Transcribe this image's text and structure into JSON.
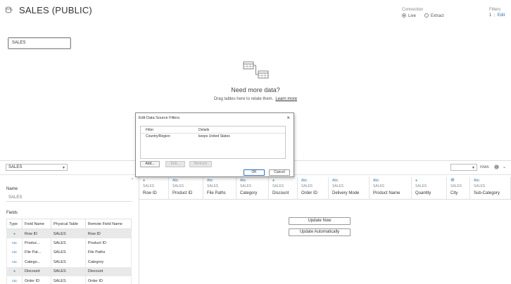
{
  "header": {
    "title": "SALES (PUBLIC)",
    "connection_label": "Connection",
    "connection_options": [
      "Live",
      "Extract"
    ],
    "connection_selected": "Live",
    "filters_label": "Filters",
    "filters_count": "1",
    "filters_edit": "Edit"
  },
  "canvas": {
    "table_chip": "SALES",
    "empty_title": "Need more data?",
    "empty_subtitle": "Drag tables here to relate them.",
    "learn_more": "Learn more"
  },
  "toolbar": {
    "connection_select": "SALES",
    "rows_label": "rows"
  },
  "left_panel": {
    "name_label": "Name",
    "name_value": "SALES",
    "fields_label": "Fields",
    "columns": [
      "Type",
      "Field Name",
      "Physical Table",
      "Remote Field Name"
    ],
    "rows": [
      {
        "type": "num",
        "field": "Row ID",
        "table": "SALES",
        "remote": "Row ID",
        "selected": true
      },
      {
        "type": "abc",
        "field": "Produc...",
        "table": "SALES",
        "remote": "Product ID",
        "selected": false
      },
      {
        "type": "abc",
        "field": "File Pat...",
        "table": "SALES",
        "remote": "File Paths",
        "selected": false
      },
      {
        "type": "abc",
        "field": "Catego...",
        "table": "SALES",
        "remote": "Category",
        "selected": false
      },
      {
        "type": "num",
        "field": "Discount",
        "table": "SALES",
        "remote": "Discount",
        "selected": true
      },
      {
        "type": "abc",
        "field": "Order ID",
        "table": "SALES",
        "remote": "Order ID",
        "selected": false
      }
    ]
  },
  "grid": {
    "columns": [
      {
        "type": "num",
        "type_label": "#",
        "source": "SALES",
        "name": "Row ID"
      },
      {
        "type": "abc",
        "type_label": "Abc",
        "source": "SALES",
        "name": "Product ID"
      },
      {
        "type": "abc",
        "type_label": "Abc",
        "source": "SALES",
        "name": "File Paths"
      },
      {
        "type": "abc",
        "type_label": "Abc",
        "source": "SALES",
        "name": "Category"
      },
      {
        "type": "num",
        "type_label": "#",
        "source": "SALES",
        "name": "Discount"
      },
      {
        "type": "abc",
        "type_label": "Abc",
        "source": "SALES",
        "name": "Order ID"
      },
      {
        "type": "abc",
        "type_label": "Abc",
        "source": "SALES",
        "name": "Delivery Mode"
      },
      {
        "type": "abc",
        "type_label": "Abc",
        "source": "SALES",
        "name": "Product Name"
      },
      {
        "type": "num",
        "type_label": "#",
        "source": "SALES",
        "name": "Quantity"
      },
      {
        "type": "geo",
        "type_label": "globe",
        "source": "SALES",
        "name": "City"
      },
      {
        "type": "abc",
        "type_label": "Abc",
        "source": "SALES",
        "name": "Sub-Category"
      }
    ],
    "update_now": "Update Now",
    "update_auto": "Update Automatically"
  },
  "dialog": {
    "title": "Edit Data Source Filters",
    "col_filter": "Filter",
    "col_details": "Details",
    "row_filter": "Country/Region",
    "row_details": "keeps United States",
    "add": "Add...",
    "edit": "Edit...",
    "remove": "Remove",
    "ok": "OK",
    "cancel": "Cancel"
  },
  "colors": {
    "abc": "#3c7ab8",
    "num": "#2fa58a",
    "ok_border": "#2b6fc0"
  }
}
